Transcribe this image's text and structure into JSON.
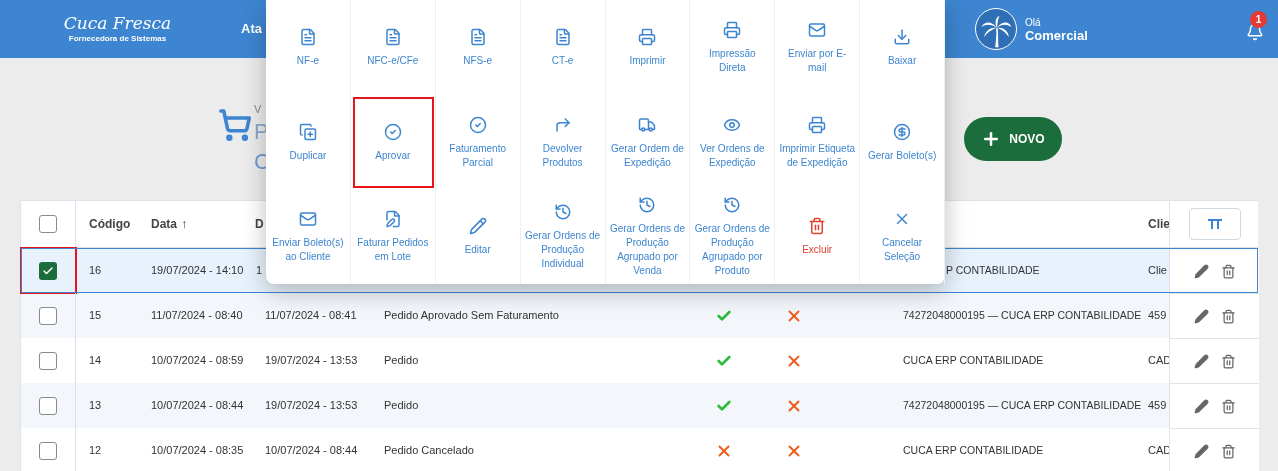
{
  "header": {
    "logo": "Cuca Fresca",
    "logo_tagline": "Fornecedora de Sistemas",
    "nav_item": "Ata",
    "greeting": "Olá",
    "user": "Comercial",
    "notifications": "1"
  },
  "page": {
    "breadcrumb": "V",
    "title_line_1": "P",
    "title_line_2": "C",
    "new_button": "NOVO"
  },
  "actions_menu": [
    {
      "label": "NF-e",
      "kind": "action",
      "highlighted": false
    },
    {
      "label": "NFC-e/CFe",
      "kind": "action",
      "highlighted": false
    },
    {
      "label": "NFS-e",
      "kind": "action",
      "highlighted": false
    },
    {
      "label": "CT-e",
      "kind": "action",
      "highlighted": false
    },
    {
      "label": "Imprimir",
      "kind": "action",
      "highlighted": false
    },
    {
      "label": "Impressão Direta",
      "kind": "action",
      "highlighted": false
    },
    {
      "label": "Enviar por E-mail",
      "kind": "action",
      "highlighted": false
    },
    {
      "label": "Baixar",
      "kind": "action",
      "highlighted": false
    },
    {
      "label": "Duplicar",
      "kind": "action",
      "highlighted": false
    },
    {
      "label": "Aprovar",
      "kind": "action",
      "highlighted": true
    },
    {
      "label": "Faturamento Parcial",
      "kind": "action",
      "highlighted": false
    },
    {
      "label": "Devolver Produtos",
      "kind": "action",
      "highlighted": false
    },
    {
      "label": "Gerar Ordem de Expedição",
      "kind": "action",
      "highlighted": false
    },
    {
      "label": "Ver Ordens de Expedição",
      "kind": "action",
      "highlighted": false
    },
    {
      "label": "Imprimir Etiqueta de Expedição",
      "kind": "action",
      "highlighted": false
    },
    {
      "label": "Gerar Boleto(s)",
      "kind": "action",
      "highlighted": false
    },
    {
      "label": "Enviar Boleto(s) ao Cliente",
      "kind": "action",
      "highlighted": false
    },
    {
      "label": "Faturar Pedidos em Lote",
      "kind": "action",
      "highlighted": false
    },
    {
      "label": "Editar",
      "kind": "action",
      "highlighted": false
    },
    {
      "label": "Gerar Ordens de Produção Individual",
      "kind": "action",
      "highlighted": false
    },
    {
      "label": "Gerar Ordens de Produção Agrupado por Venda",
      "kind": "action",
      "highlighted": false
    },
    {
      "label": "Gerar Ordens de Produção Agrupado por Produto",
      "kind": "action",
      "highlighted": false
    },
    {
      "label": "Excluir",
      "kind": "danger",
      "highlighted": false
    },
    {
      "label": "Cancelar Seleção",
      "kind": "action",
      "highlighted": false
    }
  ],
  "table": {
    "all_selected": false,
    "columns": {
      "code": "Código",
      "created": "Data",
      "created_sort_mark": "↑",
      "changed": "D",
      "client": "Clie"
    },
    "rows": [
      {
        "selected": true,
        "highlighted": true,
        "code": "16",
        "created": "19/07/2024 - 14:10",
        "changed": "1",
        "customer": "P CONTABILIDADE",
        "client": "Clie"
      },
      {
        "selected": false,
        "highlighted": false,
        "code": "15",
        "created": "11/07/2024 - 08:40",
        "changed": "11/07/2024 - 08:41",
        "status": "Pedido Aprovado Sem Faturamento",
        "approved": true,
        "invoiced": false,
        "customer": "74272048000195 — CUCA ERP CONTABILIDADE",
        "client": "459"
      },
      {
        "selected": false,
        "highlighted": false,
        "code": "14",
        "created": "10/07/2024 - 08:59",
        "changed": "19/07/2024 - 13:53",
        "status": "Pedido",
        "approved": true,
        "invoiced": false,
        "customer": "CUCA ERP CONTABILIDADE",
        "client": "CAD"
      },
      {
        "selected": false,
        "highlighted": false,
        "code": "13",
        "created": "10/07/2024 - 08:44",
        "changed": "19/07/2024 - 13:53",
        "status": "Pedido",
        "approved": true,
        "invoiced": false,
        "customer": "74272048000195 — CUCA ERP CONTABILIDADE",
        "client": "459"
      },
      {
        "selected": false,
        "highlighted": false,
        "code": "12",
        "created": "10/07/2024 - 08:35",
        "changed": "10/07/2024 - 08:44",
        "status": "Pedido Cancelado",
        "approved": false,
        "invoiced": false,
        "customer": "CUCA ERP CONTABILIDADE",
        "client": "CAD"
      }
    ]
  }
}
